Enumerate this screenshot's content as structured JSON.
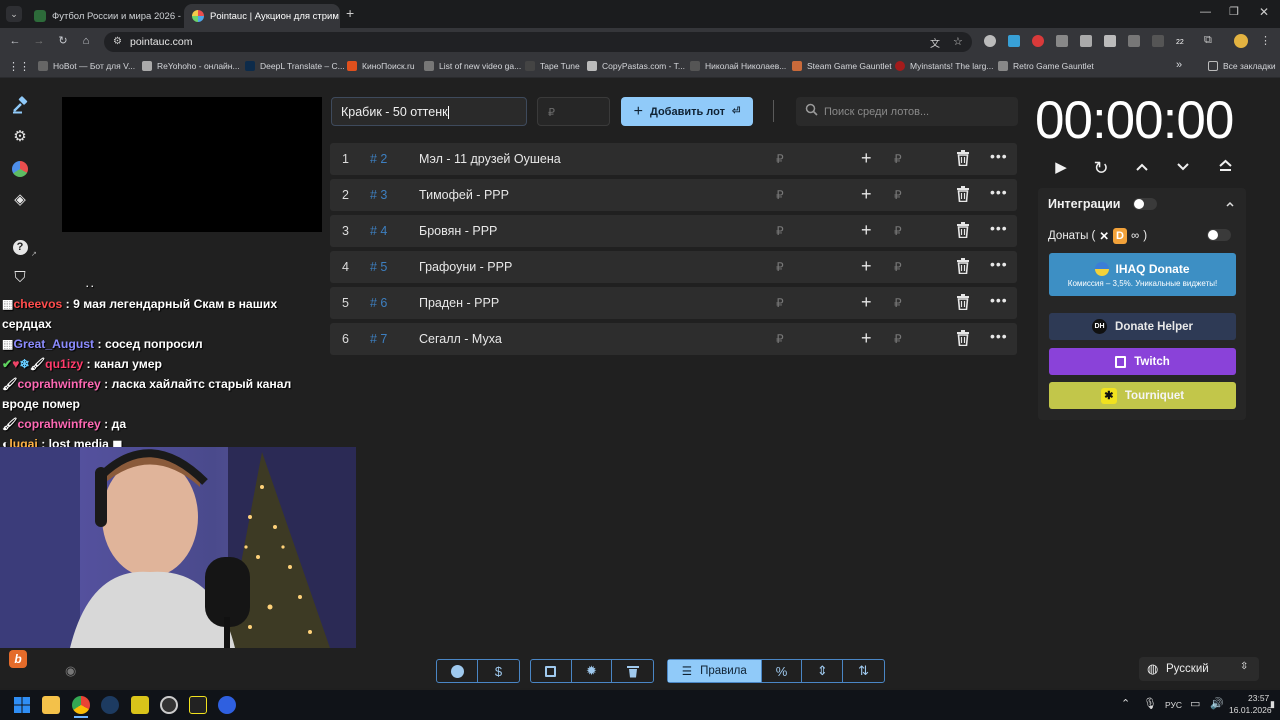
{
  "browser": {
    "tabs": [
      {
        "title": "Футбол России и мира 2026 -",
        "active": false
      },
      {
        "title": "Pointauc | Аукцион для стрим",
        "active": true
      }
    ],
    "url": "pointauc.com",
    "bookmarks": [
      "HoBot — Бот для V...",
      "ReYohoho - онлайн...",
      "DeepL Translate – C...",
      "КиноПоиск.ru",
      "List of new video ga...",
      "Tape Tune",
      "CopyPastas.com - T...",
      "Николай Николаев...",
      "Steam Game Gauntlet",
      "Myinstants! The larg...",
      "Retro Game Gauntlet"
    ],
    "all_bookmarks": "Все закладки",
    "ext_badge": "22"
  },
  "auction": {
    "lot_input_value": "Крабик - 50 оттенк",
    "price_placeholder": "₽",
    "add_button_label": "Добавить лот",
    "search_placeholder": "Поиск среди лотов...",
    "currency": "₽",
    "lots": [
      {
        "index": "1",
        "id": "# 2",
        "name": "Мэл - 11 друзей Оушена"
      },
      {
        "index": "2",
        "id": "# 3",
        "name": "Тимофей - РРР"
      },
      {
        "index": "3",
        "id": "# 4",
        "name": "Бровян - РРР"
      },
      {
        "index": "4",
        "id": "# 5",
        "name": "Графоуни - РРР"
      },
      {
        "index": "5",
        "id": "# 6",
        "name": "Праден - РРР"
      },
      {
        "index": "6",
        "id": "# 7",
        "name": "Сегалл - Муха"
      }
    ]
  },
  "timer": {
    "value": "00:00:00"
  },
  "integrations": {
    "title": "Интеграции",
    "donations_label": "Донаты (",
    "donations_close": ")",
    "ihaq_label": "IHAQ Donate",
    "ihaq_sub": "Комиссия – 3,5%. Уникальные виджеты!",
    "donate_helper_label": "Donate Helper",
    "twitch_label": "Twitch",
    "tourniquet_label": "Tourniquet",
    "colors": {
      "ihaq": "#3d8fc4",
      "donate_helper": "#2e3a55",
      "twitch": "#8a42d9",
      "tourniquet": "#c2c64a"
    }
  },
  "chat": {
    "partial_line": ". .",
    "messages": [
      {
        "user": "cheevos",
        "text": "9 мая легендарный Скам в наших сердцах"
      },
      {
        "user": "Great_August",
        "text": "сосед попросил"
      },
      {
        "user": "qu1izy",
        "text": "канал умер"
      },
      {
        "user": "coprahwinfrey",
        "text": "ласка хайлайтс старый канал вроде помер"
      },
      {
        "user": "coprahwinfrey",
        "text": "да"
      },
      {
        "user": "luqaj",
        "text": "lost media"
      }
    ]
  },
  "bottom": {
    "rules_label": "Правила",
    "language": "Русский"
  },
  "taskbar": {
    "lang": "РУС",
    "time": "23:57",
    "date": "16.01.2026"
  }
}
